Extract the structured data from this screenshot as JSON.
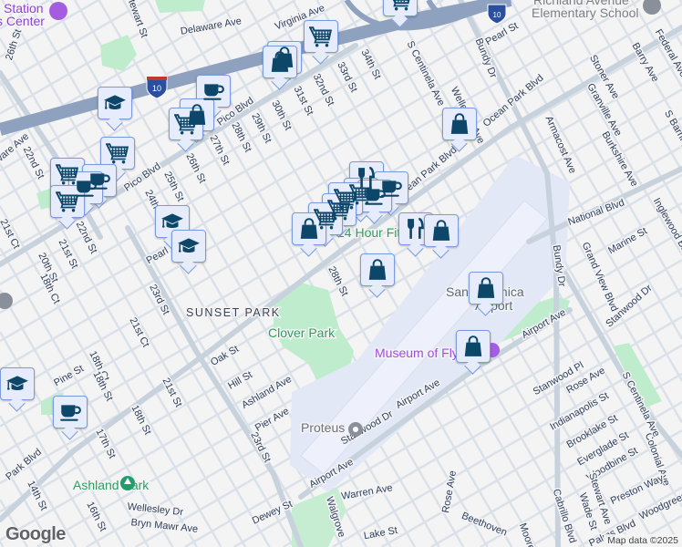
{
  "colors": {
    "background": "#f5f4f5",
    "minor_road": "#dbe1e8",
    "major_road": "#c8d2dd",
    "freeway": "#8ea1bf",
    "park": "#bfeccc",
    "airport": "#e3e8f6",
    "marker_icon": "#0c4669",
    "marker_bg": "#e6ecfb",
    "marker_border": "#7b9be0"
  },
  "pois": {
    "station_center_line1": "Station",
    "station_center_line2": "s Center",
    "richland_line1": "Richland Avenue",
    "richland_line2": "Elementary School",
    "fitness": "24 Hour Fitness",
    "airport_line1": "Santa Monica",
    "airport_line2": "Airport",
    "museum": "Museum of Flying",
    "proteus": "Proteus",
    "clover_park": "Clover Park",
    "ashland_park": "Ashland Park",
    "neighborhood": "SUNSET PARK",
    "freeway_shield": "10"
  },
  "streets": [
    "Delaware Ave",
    "Virginia Ave",
    "Stewart St",
    "26th St",
    "22nd St",
    "ware Ave",
    "Pico Blvd",
    "Pico Blvd",
    "24th St",
    "25th St",
    "26th St",
    "27th St",
    "28th St",
    "29th St",
    "30th St",
    "31st St",
    "32nd St",
    "33rd St",
    "34th St",
    "S Centinela Ave",
    "Wellesley Ave",
    "Pearl St",
    "Bundy Dr",
    "Ocean Park Blvd",
    "Ocean Park Blvd",
    "Armacost Ave",
    "Stoner Ave",
    "Granville Ave",
    "Burkshire Ave",
    "Barry Ave",
    "Federal Ave",
    "S Barrington",
    "National Blvd",
    "Bundy Dr",
    "Grand View Blvd",
    "Marine St",
    "Inglewood Blvd",
    "22nd St",
    "21st St",
    "20th St",
    "21st Ct",
    "18th Ct",
    "Pearl St",
    "28th St",
    "23rd St",
    "21st Ct",
    "Oak St",
    "Hill St",
    "Ashland Ave",
    "Pier Ave",
    "18th Ct",
    "18th St",
    "Pine St",
    "21st St",
    "18th St",
    "17th St",
    "23rd St",
    "Park Blvd",
    "14th St",
    "16th St",
    "Wellesley Dr",
    "Bryn Mawr Ave",
    "Dewey St",
    "Walgrove",
    "Airport Ave",
    "Airport Ave",
    "Airport Ave",
    "Stanwood Dr",
    "Stanwood Pl",
    "Stanwood Dr",
    "Rose Ave",
    "Indianapolis St",
    "Brooklake St",
    "Everglade St",
    "Woodbine St",
    "Colonial Ave",
    "S Centinela Ave",
    "Stewart Ave",
    "Wade St",
    "Cabrillo Blvd",
    "Preston Way",
    "Palms Blvd",
    "Woodgreen St",
    "Warren Ave",
    "Rose Ave",
    "Beethoven",
    "Lake St",
    "Moore"
  ],
  "markers": [
    "cart-icon",
    "shopping-bag-icon",
    "shopping-bag-icon",
    "coffee-cup-icon",
    "graduation-cap-icon",
    "shopping-bag-icon",
    "cart-icon",
    "cart-icon",
    "cart-icon",
    "coffee-cup-icon",
    "coffee-cup-icon",
    "cart-icon",
    "graduation-cap-icon",
    "graduation-cap-icon",
    "fork-knife-icon",
    "coffee-cup-icon",
    "cart-icon",
    "coffee-cup-icon",
    "cart-icon",
    "cart-icon",
    "cart-icon",
    "shopping-bag-icon",
    "shopping-bag-icon",
    "fork-knife-icon",
    "shopping-bag-icon",
    "shopping-bag-icon",
    "shopping-bag-icon",
    "graduation-cap-icon",
    "coffee-cup-icon",
    "cart-icon"
  ],
  "footer": {
    "logo": "Google",
    "attribution": "Map data ©2025"
  }
}
